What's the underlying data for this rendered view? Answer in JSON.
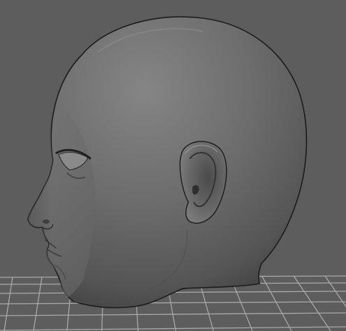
{
  "viewport": {
    "background_color": "#5d5d5d",
    "grid_line_color": "#a9a9a9",
    "grid_visible": true,
    "model_base_color": "#5e5e5e",
    "model_highlight_color": "#848484",
    "model_shadow_color": "#3c3c3c",
    "model_outline_color": "#1b1b1b"
  },
  "model": {
    "name": "head-mesh",
    "features": [
      "cranium",
      "ear",
      "eye",
      "nose",
      "lips",
      "chin",
      "neck-cut"
    ]
  }
}
